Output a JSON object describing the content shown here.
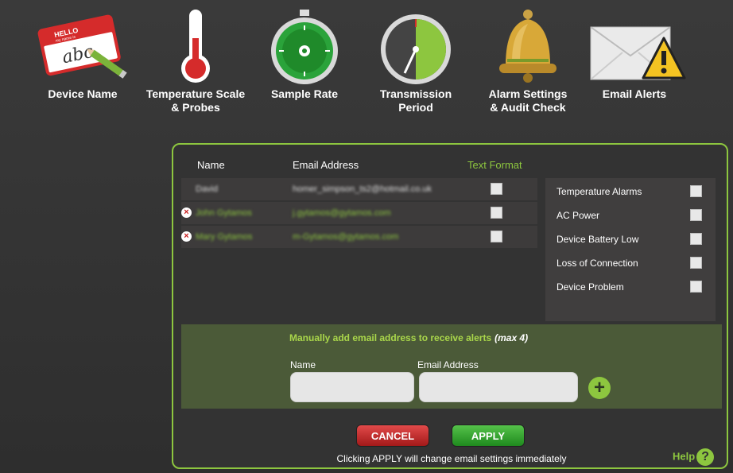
{
  "nav": [
    {
      "label": "Device Name",
      "icon": "hello-name-tag-icon"
    },
    {
      "label": "Temperature Scale\n& Probes",
      "icon": "thermometer-icon"
    },
    {
      "label": "Sample Rate",
      "icon": "stopwatch-icon"
    },
    {
      "label": "Transmission\nPeriod",
      "icon": "clock-dial-icon"
    },
    {
      "label": "Alarm Settings\n& Audit Check",
      "icon": "bell-icon"
    },
    {
      "label": "Email Alerts",
      "icon": "envelope-warning-icon",
      "active": true
    }
  ],
  "name_tag": {
    "hello": "HELLO",
    "my_name_is": "my name is",
    "text": "abc"
  },
  "table": {
    "header_name": "Name",
    "header_email": "Email Address",
    "header_text_format": "Text Format",
    "rows": [
      {
        "name": "David",
        "email": "homer_simpson_ts2@hotmail.co.uk",
        "deletable": false
      },
      {
        "name": "John Gytamos",
        "email": "j.gytamos@gytamos.com",
        "deletable": true
      },
      {
        "name": "Mary Gytamos",
        "email": "m-Gytamos@gytamos.com",
        "deletable": true
      }
    ]
  },
  "alert_types": [
    "Temperature Alarms",
    "AC Power",
    "Device Battery Low",
    "Loss of Connection",
    "Device Problem"
  ],
  "add": {
    "title": "Manually add email address to receive alerts",
    "max_note": "(max 4)",
    "name_label": "Name",
    "email_label": "Email Address",
    "plus": "+"
  },
  "buttons": {
    "cancel": "CANCEL",
    "apply": "APPLY"
  },
  "notice": "Clicking APPLY will change email settings immediately",
  "help": {
    "label": "Help",
    "icon": "?"
  },
  "colors": {
    "accent": "#8dc63f",
    "cancel": "#c42a2a",
    "apply": "#2fa52a"
  }
}
